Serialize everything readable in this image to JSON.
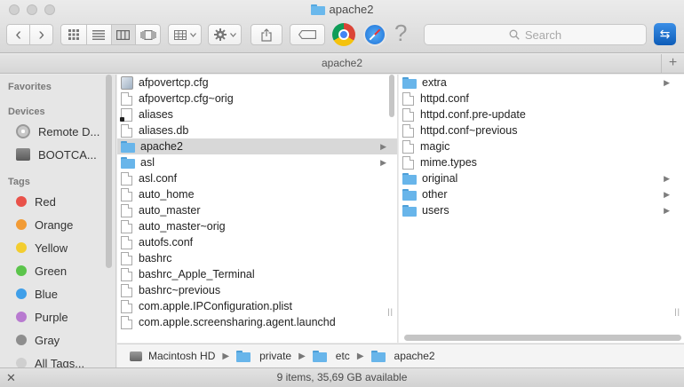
{
  "window": {
    "title": "apache2"
  },
  "toolbar": {
    "back_icon": "‹",
    "forward_icon": "›",
    "search_placeholder": "Search"
  },
  "tabbar": {
    "title": "apache2",
    "add_label": "+"
  },
  "sidebar": {
    "favorites_heading": "Favorites",
    "devices_heading": "Devices",
    "devices": [
      {
        "label": "Remote D...",
        "icon": "optical-disc-icon"
      },
      {
        "label": "BOOTCA...",
        "icon": "hard-drive-icon"
      }
    ],
    "tags_heading": "Tags",
    "tags": [
      {
        "label": "Red",
        "color": "#e9524a"
      },
      {
        "label": "Orange",
        "color": "#f29b35"
      },
      {
        "label": "Yellow",
        "color": "#f3cd2f"
      },
      {
        "label": "Green",
        "color": "#5bc44b"
      },
      {
        "label": "Blue",
        "color": "#3f9fe9"
      },
      {
        "label": "Purple",
        "color": "#b87ad0"
      },
      {
        "label": "Gray",
        "color": "#8e8e8e"
      },
      {
        "label": "All Tags...",
        "color": "#cfcfcf"
      }
    ]
  },
  "column1": [
    {
      "name": "afpovertcp.cfg",
      "kind": "config"
    },
    {
      "name": "afpovertcp.cfg~orig",
      "kind": "file"
    },
    {
      "name": "aliases",
      "kind": "alias"
    },
    {
      "name": "aliases.db",
      "kind": "file"
    },
    {
      "name": "apache2",
      "kind": "folder",
      "selected": true
    },
    {
      "name": "asl",
      "kind": "folder"
    },
    {
      "name": "asl.conf",
      "kind": "file"
    },
    {
      "name": "auto_home",
      "kind": "file"
    },
    {
      "name": "auto_master",
      "kind": "file"
    },
    {
      "name": "auto_master~orig",
      "kind": "file"
    },
    {
      "name": "autofs.conf",
      "kind": "file"
    },
    {
      "name": "bashrc",
      "kind": "file"
    },
    {
      "name": "bashrc_Apple_Terminal",
      "kind": "file"
    },
    {
      "name": "bashrc~previous",
      "kind": "file"
    },
    {
      "name": "com.apple.IPConfiguration.plist",
      "kind": "file"
    },
    {
      "name": "com.apple.screensharing.agent.launchd",
      "kind": "file"
    }
  ],
  "column2": [
    {
      "name": "extra",
      "kind": "folder"
    },
    {
      "name": "httpd.conf",
      "kind": "file"
    },
    {
      "name": "httpd.conf.pre-update",
      "kind": "file"
    },
    {
      "name": "httpd.conf~previous",
      "kind": "file"
    },
    {
      "name": "magic",
      "kind": "file"
    },
    {
      "name": "mime.types",
      "kind": "file"
    },
    {
      "name": "original",
      "kind": "folder"
    },
    {
      "name": "other",
      "kind": "folder"
    },
    {
      "name": "users",
      "kind": "folder"
    }
  ],
  "pathbar": {
    "crumbs": [
      {
        "label": "Macintosh HD",
        "icon": "hard-drive-icon"
      },
      {
        "label": "private",
        "icon": "folder-icon"
      },
      {
        "label": "etc",
        "icon": "folder-icon"
      },
      {
        "label": "apache2",
        "icon": "folder-icon"
      }
    ]
  },
  "status": {
    "text": "9 items, 35,69 GB available"
  }
}
